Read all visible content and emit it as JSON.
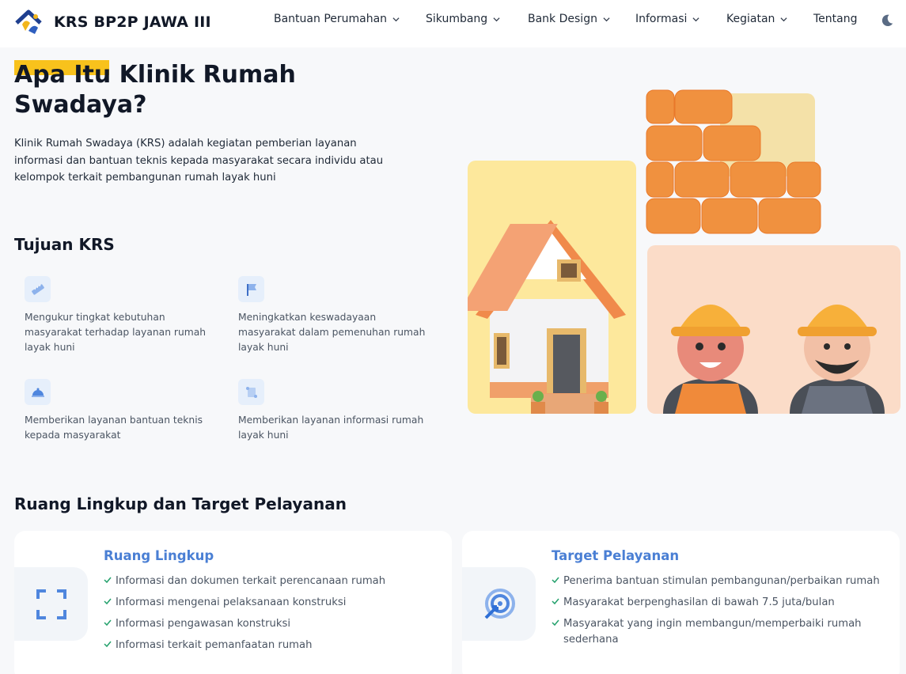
{
  "brand": {
    "name": "KRS BP2P JAWA III"
  },
  "nav": [
    {
      "label": "Bantuan Perumahan",
      "has_dropdown": true
    },
    {
      "label": "Sikumbang",
      "has_dropdown": true
    },
    {
      "label": "Bank Design",
      "has_dropdown": true
    },
    {
      "label": "Informasi",
      "has_dropdown": true
    },
    {
      "label": "Kegiatan",
      "has_dropdown": true
    },
    {
      "label": "Tentang",
      "has_dropdown": false
    }
  ],
  "hero": {
    "title": "Apa Itu Klinik Rumah Swadaya?",
    "description": "Klinik Rumah Swadaya (KRS) adalah kegiatan pemberian layanan informasi dan bantuan teknis kepada masyarakat secara individu atau kelompok terkait pembangunan rumah layak huni"
  },
  "goals": {
    "heading": "Tujuan KRS",
    "items": [
      {
        "icon": "ruler-icon",
        "text": "Mengukur tingkat kebutuhan masyarakat terhadap layanan rumah layak huni"
      },
      {
        "icon": "flag-icon",
        "text": "Meningkatkan keswadayaan masyarakat dalam pemenuhan rumah layak huni"
      },
      {
        "icon": "service-bell-icon",
        "text": "Memberikan layanan bantuan teknis kepada masyarakat"
      },
      {
        "icon": "scroll-icon",
        "text": "Memberikan layanan informasi rumah layak huni"
      }
    ]
  },
  "scope": {
    "heading": "Ruang Lingkup dan Target Pelayanan",
    "cards": [
      {
        "icon": "scan-frame-icon",
        "title": "Ruang Lingkup",
        "items": [
          "Informasi dan dokumen terkait perencanaan rumah",
          "Informasi mengenai pelaksanaan konstruksi",
          "Informasi pengawasan konstruksi",
          "Informasi terkait pemanfaatan rumah"
        ]
      },
      {
        "icon": "target-cursor-icon",
        "title": "Target Pelayanan",
        "items": [
          "Penerima bantuan stimulan pembangunan/perbaikan rumah",
          "Masyarakat berpenghasilan di bawah 7.5 juta/bulan",
          "Masyarakat yang ingin membangun/memperbaiki rumah sederhana"
        ]
      }
    ]
  },
  "colors": {
    "accent": "#4a7fd4",
    "highlight": "#f8c21c",
    "house_card": "#fde89c",
    "workers_card": "#fbdcc8"
  }
}
